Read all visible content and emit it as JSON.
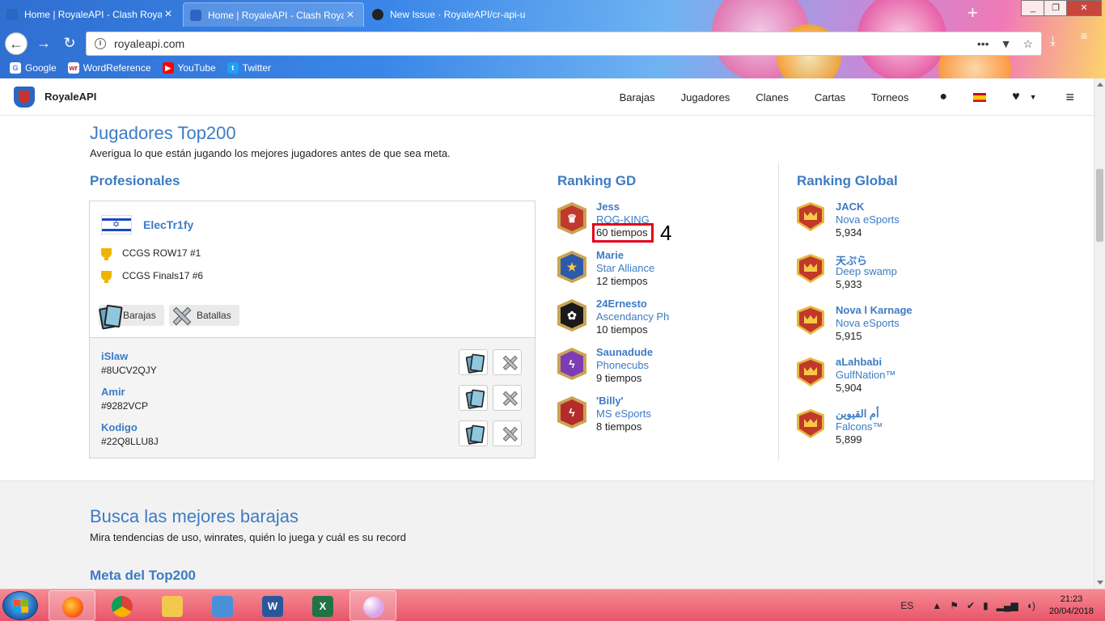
{
  "browser": {
    "tabs": [
      {
        "title": "Home | RoyaleAPI - Clash Royale",
        "active": false,
        "favicon_color": "#2b66c2"
      },
      {
        "title": "Home | RoyaleAPI - Clash Royale",
        "active": true,
        "favicon_color": "#2b66c2"
      },
      {
        "title": "New Issue · RoyaleAPI/cr-api-u",
        "active": false,
        "favicon_color": "#222222"
      }
    ],
    "new_tab_icon": "plus-icon",
    "url": "royaleapi.com",
    "bookmarks": [
      {
        "label": "Google",
        "icon": "G",
        "color": "#ffffff"
      },
      {
        "label": "WordReference",
        "icon": "wr",
        "color": "#ffffff"
      },
      {
        "label": "YouTube",
        "icon": "▶",
        "color": "#ff0000"
      },
      {
        "label": "Twitter",
        "icon": "t",
        "color": "#1da1f2"
      }
    ]
  },
  "site": {
    "brand": "RoyaleAPI",
    "nav": [
      "Barajas",
      "Jugadores",
      "Clanes",
      "Cartas",
      "Torneos"
    ]
  },
  "top200": {
    "title": "Jugadores Top200",
    "subtitle": "Averigua lo que están jugando los mejores jugadores antes de que sea meta.",
    "pros_title": "Profesionales",
    "pro": {
      "name": "ElecTr1fy",
      "achievements": [
        "CCGS ROW17 #1",
        "CCGS Finals17 #6"
      ],
      "decks_label": "Barajas",
      "battles_label": "Batallas",
      "accounts": [
        {
          "name": "iSlaw",
          "tag": "#8UCV2QJY"
        },
        {
          "name": "Amir",
          "tag": "#9282VCP"
        },
        {
          "name": "Kodigo",
          "tag": "#22Q8LLU8J"
        }
      ]
    },
    "gd_title": "Ranking GD",
    "gd": [
      {
        "name": "Jess",
        "clan": "ROG-KING",
        "value": "60 tiempos",
        "badge_color": "#c0392b",
        "emblem": "♛"
      },
      {
        "name": "Marie",
        "clan": "Star Alliance",
        "value": "12 tiempos",
        "badge_color": "#2d5aa8",
        "emblem": "★"
      },
      {
        "name": "24Ernesto",
        "clan": "Ascendancy Ph",
        "value": "10 tiempos",
        "badge_color": "#1a1a1a",
        "emblem": "✿"
      },
      {
        "name": "Saunadude",
        "clan": "Phonecubs",
        "value": "9 tiempos",
        "badge_color": "#7d3cb5",
        "emblem": "ϟ"
      },
      {
        "name": "'Billy'",
        "clan": "MS eSports",
        "value": "8 tiempos",
        "badge_color": "#b52b2b",
        "emblem": "ϟ"
      }
    ],
    "global_title": "Ranking Global",
    "global": [
      {
        "name": "JACK",
        "clan": "Nova eSports",
        "value": "5,934"
      },
      {
        "name": "天ぷら",
        "clan": "Deep swamp",
        "value": "5,933"
      },
      {
        "name": "Nova l Karnage",
        "clan": "Nova eSports",
        "value": "5,915"
      },
      {
        "name": "aLahbabi",
        "clan": "GulfNation™",
        "value": "5,904"
      },
      {
        "name": "أم القيوين",
        "clan": "Falcons™",
        "value": "5,899"
      }
    ]
  },
  "annotation": {
    "label": "4",
    "color": "#e2001a"
  },
  "decks": {
    "title": "Busca las mejores barajas",
    "subtitle": "Mira tendencias de uso, winrates, quién lo juega y cuál es su record",
    "meta_title": "Meta del Top200"
  },
  "taskbar": {
    "lang": "ES",
    "time": "21:23",
    "date": "20/04/2018",
    "apps": [
      {
        "name": "firefox",
        "color": "#ff7a1a",
        "active": true
      },
      {
        "name": "chrome",
        "color": "#4caf50",
        "active": false
      },
      {
        "name": "explorer",
        "color": "#f2c94c",
        "active": false
      },
      {
        "name": "control-panel",
        "color": "#4a90d9",
        "active": false
      },
      {
        "name": "word",
        "color": "#2b579a",
        "active": false
      },
      {
        "name": "excel",
        "color": "#217346",
        "active": false
      },
      {
        "name": "paint",
        "color": "#d9a5e6",
        "active": true
      }
    ]
  }
}
